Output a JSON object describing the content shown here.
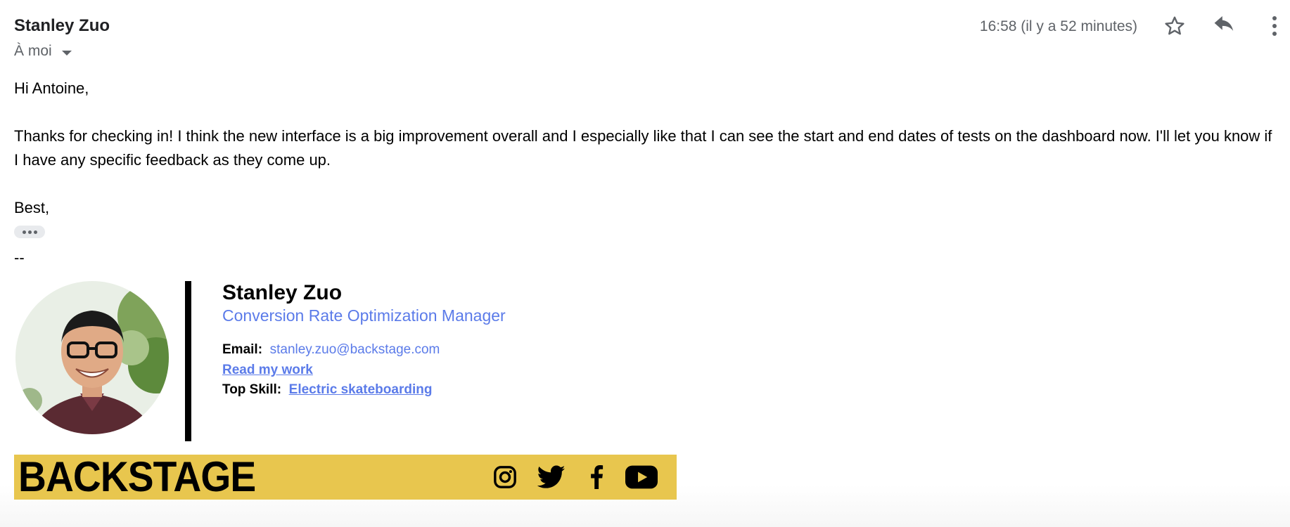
{
  "header": {
    "sender_name": "Stanley Zuo",
    "recipient_label": "À moi",
    "timestamp": "16:58 (il y a 52 minutes)",
    "icons": [
      "star-icon",
      "reply-icon",
      "more-vert-icon"
    ]
  },
  "body": {
    "greeting": "Hi Antoine,",
    "paragraph": "Thanks for checking in! I think the new interface is a big improvement overall and I especially like that I can see the start and end dates of tests on the dashboard now. I'll let you know if I have any specific feedback as they come up.",
    "closing": "Best,",
    "signature_separator": "--"
  },
  "signature": {
    "name": "Stanley Zuo",
    "title": "Conversion Rate Optimization Manager",
    "email_label": "Email:",
    "email_value": "stanley.zuo@backstage.com",
    "read_link": "Read my work",
    "skill_label": "Top Skill:",
    "skill_value": "Electric skateboarding"
  },
  "banner": {
    "brand": "BACKSTAGE",
    "background": "#e8c64e",
    "social_icons": [
      "instagram-icon",
      "twitter-icon",
      "facebook-icon",
      "youtube-icon"
    ]
  },
  "colors": {
    "link": "#5b7be9",
    "muted": "#5f6368"
  }
}
